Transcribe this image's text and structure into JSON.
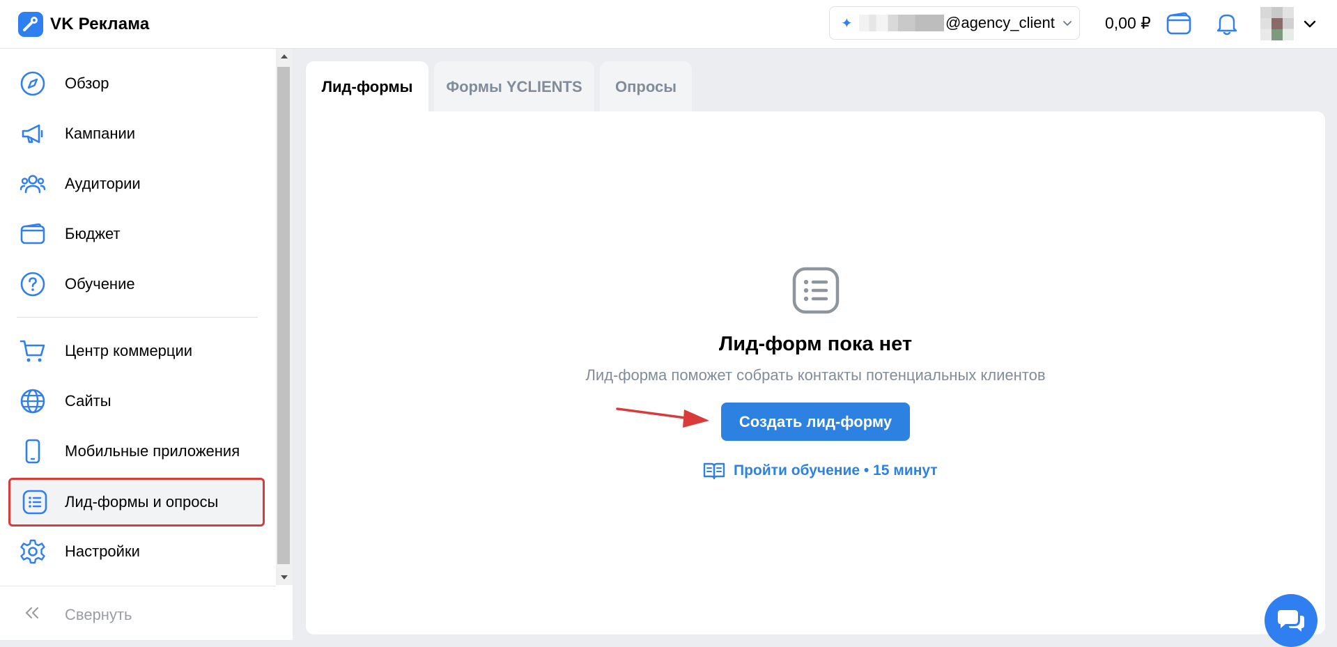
{
  "header": {
    "app_name": "VK Реклама",
    "account_name": "@agency_client",
    "balance": "0,00 ₽"
  },
  "sidebar": {
    "items": [
      {
        "label": "Обзор",
        "icon": "compass-icon"
      },
      {
        "label": "Кампании",
        "icon": "megaphone-icon"
      },
      {
        "label": "Аудитории",
        "icon": "users-icon"
      },
      {
        "label": "Бюджет",
        "icon": "wallet-icon"
      },
      {
        "label": "Обучение",
        "icon": "help-circle-icon"
      },
      {
        "label": "Центр коммерции",
        "icon": "cart-icon"
      },
      {
        "label": "Сайты",
        "icon": "globe-icon"
      },
      {
        "label": "Мобильные приложения",
        "icon": "phone-icon"
      },
      {
        "label": "Лид-формы и опросы",
        "icon": "list-icon",
        "active": true
      },
      {
        "label": "Настройки",
        "icon": "gear-icon"
      }
    ],
    "collapse_label": "Свернуть"
  },
  "tabs": [
    {
      "label": "Лид-формы",
      "active": true
    },
    {
      "label": "Формы YCLIENTS"
    },
    {
      "label": "Опросы"
    }
  ],
  "empty_state": {
    "title": "Лид-форм пока нет",
    "subtitle": "Лид-форма поможет собрать контакты потенциальных клиентов",
    "create_button": "Создать лид-форму",
    "learn_link": "Пройти обучение • 15 минут"
  },
  "colors": {
    "accent": "#2d81e0",
    "highlight_border": "#d93b3b",
    "icon_blue": "#2f7ff0",
    "muted_text": "#818c99"
  }
}
